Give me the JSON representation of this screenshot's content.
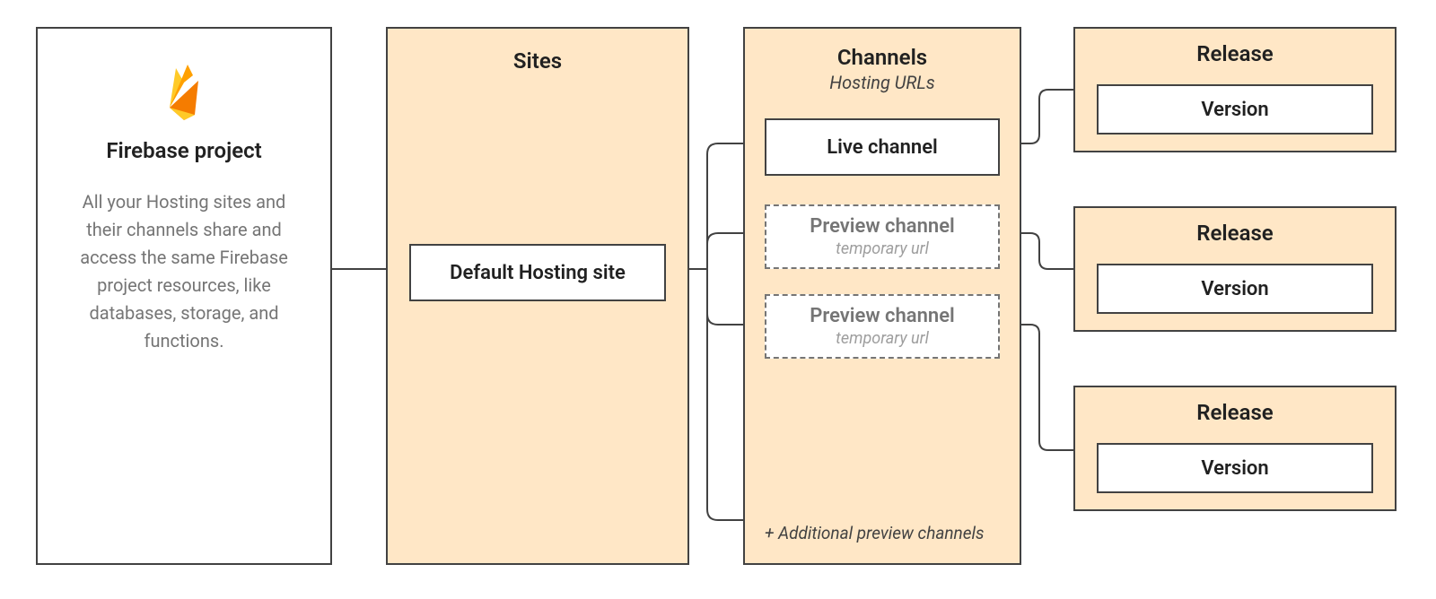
{
  "project": {
    "title": "Firebase project",
    "description": "All your Hosting sites and their channels share and access the same Firebase project resources, like databases, storage, and functions."
  },
  "sites": {
    "title": "Sites",
    "default_site": "Default Hosting site"
  },
  "channels": {
    "title": "Channels",
    "subtitle": "Hosting URLs",
    "live": "Live channel",
    "preview1": {
      "label": "Preview channel",
      "sub": "temporary url"
    },
    "preview2": {
      "label": "Preview channel",
      "sub": "temporary url"
    },
    "additional": "+ Additional preview channels"
  },
  "release": {
    "title": "Release",
    "version": "Version"
  }
}
